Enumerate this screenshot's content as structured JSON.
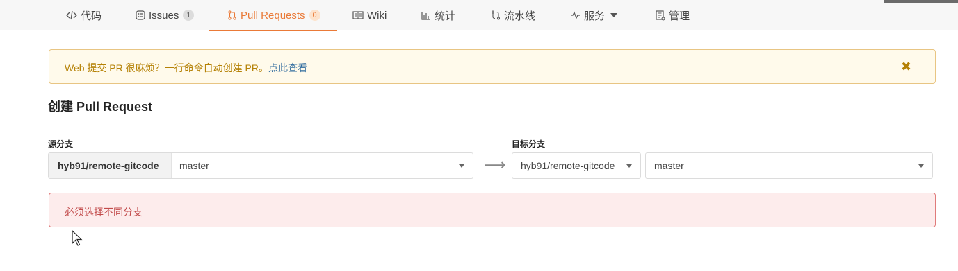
{
  "nav": {
    "tabs": [
      {
        "label": "代码",
        "icon": "code-icon",
        "active": false
      },
      {
        "label": "Issues",
        "icon": "issues-icon",
        "count": "1",
        "active": false
      },
      {
        "label": "Pull Requests",
        "icon": "pull-request-icon",
        "count": "0",
        "active": true
      },
      {
        "label": "Wiki",
        "icon": "wiki-book-icon",
        "active": false
      },
      {
        "label": "统计",
        "icon": "bar-chart-icon",
        "active": false
      },
      {
        "label": "流水线",
        "icon": "pipeline-icon",
        "active": false
      },
      {
        "label": "服务",
        "icon": "pulse-icon",
        "active": false,
        "dropdown": true
      },
      {
        "label": "管理",
        "icon": "manage-icon",
        "active": false
      }
    ],
    "accent_color": "#ea7a38"
  },
  "banner": {
    "text": "Web 提交 PR 很麻烦？一行命令自动创建 PR。",
    "link": "点此查看",
    "close": "✖"
  },
  "page": {
    "title": "创建 Pull Request"
  },
  "source": {
    "label": "源分支",
    "repo": "hyb91/remote-gitcode",
    "branch": "master"
  },
  "target": {
    "label": "目标分支",
    "repo": "hyb91/remote-gitcode",
    "branch": "master"
  },
  "arrow": "⟶",
  "error": {
    "message": "必须选择不同分支"
  }
}
